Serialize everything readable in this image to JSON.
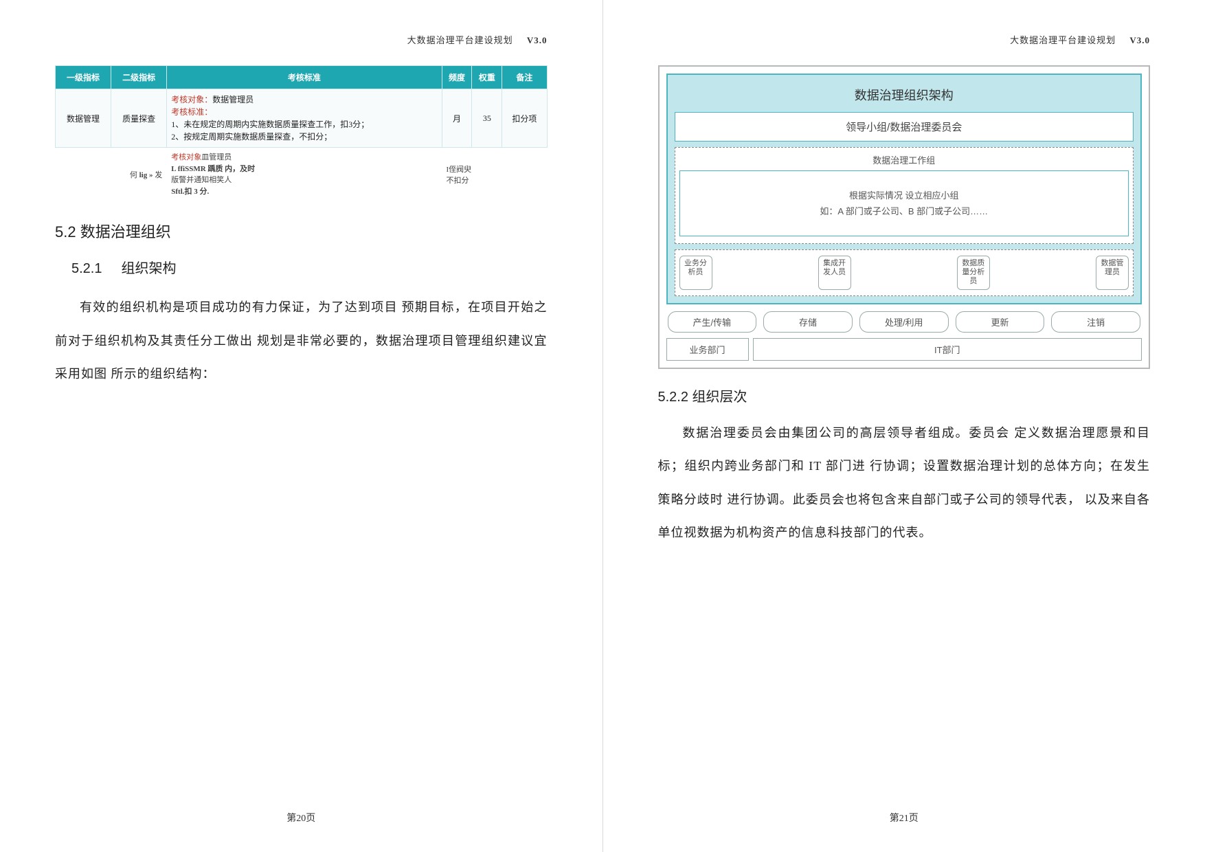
{
  "doc": {
    "title": "大数据治理平台建设规划",
    "version": "V3.0"
  },
  "left": {
    "page_no": "第20页",
    "table": {
      "head": [
        "一级指标",
        "二级指标",
        "考核标准",
        "频度",
        "权重",
        "备注"
      ],
      "row1": {
        "c1": "数据管理",
        "c2": "质量探查",
        "c3_label1": "考核对象：",
        "c3_label1v": "数据管理员",
        "c3_label2": "考核标准：",
        "c3_li1": "1、未在规定的周期内实施数据质量探查工作，扣3分；",
        "c3_li2": "2、按规定周期实施数据质量探查，不扣分；",
        "c4": "月",
        "c5": "35",
        "c6": "扣分项"
      },
      "note": {
        "left_a": "何 ",
        "left_bold": "lig » ",
        "left_b": "发",
        "red": "考核对象",
        "red_tail": "皿管理员",
        "mid1": "L ffiSSMR 踽质 内，及时",
        "mid2": "版警并通知相笑人",
        "mid3": "Sftl.扣 3 分.",
        "right1": "I侄阀臾",
        "right2": "不扣分"
      }
    },
    "h2": "5.2 数据治理组织",
    "h3_num": "5.2.1",
    "h3_txt": "组织架构",
    "para": "有效的组织机构是项目成功的有力保证，为了达到项目 预期目标，在项目开始之前对于组织机构及其责任分工做出 规划是非常必要的，数据治理项目管理组织建议宜采用如图 所示的组织结构："
  },
  "right": {
    "page_no": "第21页",
    "diagram": {
      "title": "数据治理组织架构",
      "lead": "领导小组/数据治理委员会",
      "work_title": "数据治理工作组",
      "work_line1": "根据实际情况 设立相应小组",
      "work_line2": "如：A 部门或子公司、B 部门或子公司……",
      "roles": [
        "业务分析员",
        "集成开发人员",
        "数据质量分析员",
        "数据管理员"
      ],
      "lifecycle": [
        "产生/传输",
        "存储",
        "处理/利用",
        "更新",
        "注销"
      ],
      "dept_biz": "业务部门",
      "dept_it": "IT部门"
    },
    "h3": "5.2.2 组织层次",
    "para": "数据治理委员会由集团公司的高层领导者组成。委员会 定义数据治理愿景和目标；组织内跨业务部门和 IT 部门进 行协调；设置数据治理计划的总体方向；在发生策略分歧时 进行协调。此委员会也将包含来自部门或子公司的领导代表， 以及来自各单位视数据为机构资产的信息科技部门的代表。"
  }
}
